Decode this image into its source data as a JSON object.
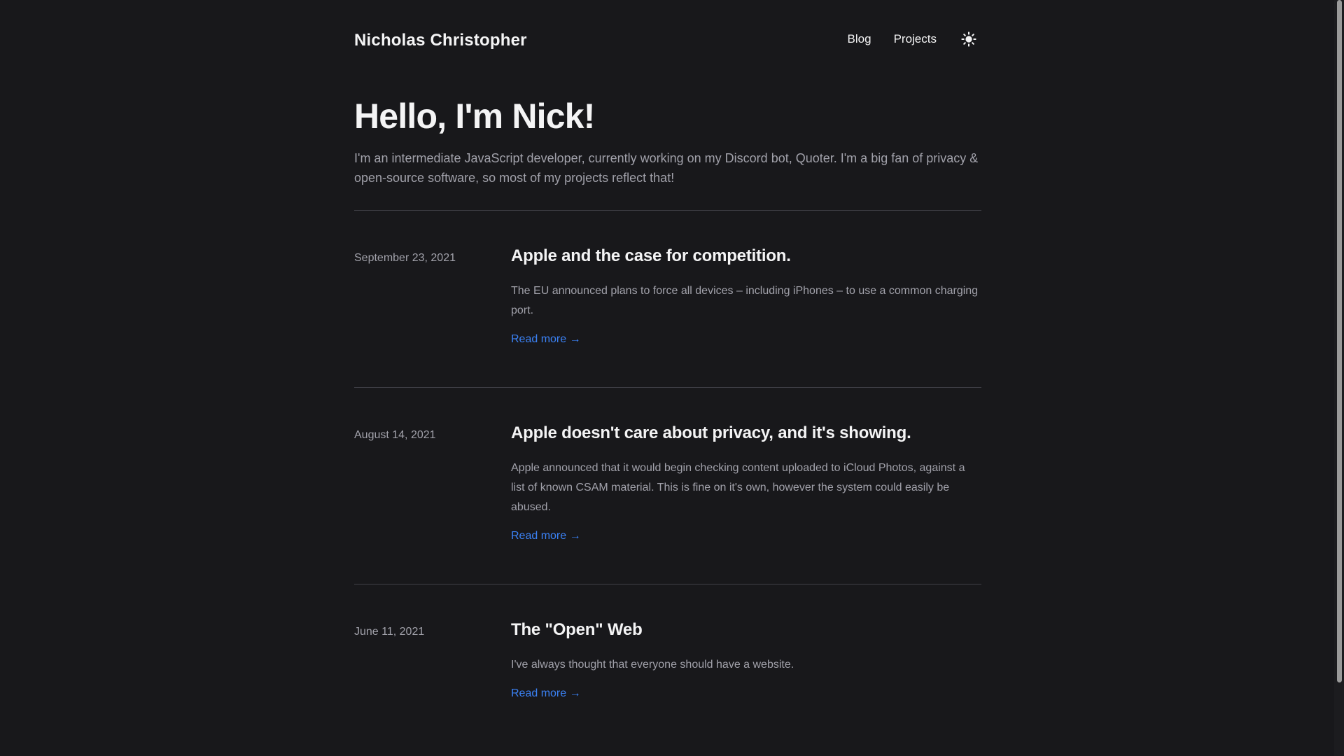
{
  "header": {
    "site_title": "Nicholas Christopher",
    "nav": {
      "blog": "Blog",
      "projects": "Projects"
    },
    "theme_toggle_icon": "sun-icon"
  },
  "hero": {
    "title": "Hello, I'm Nick!",
    "intro": "I'm an intermediate JavaScript developer, currently working on my Discord bot, Quoter. I'm a big fan of privacy & open-source software, so most of my projects reflect that!"
  },
  "posts": [
    {
      "date": "September 23, 2021",
      "title": "Apple and the case for competition.",
      "excerpt": "The EU announced plans to force all devices – including iPhones – to use a common charging port.",
      "read_more": "Read more →"
    },
    {
      "date": "August 14, 2021",
      "title": "Apple doesn't care about privacy, and it's showing.",
      "excerpt": "Apple announced that it would begin checking content uploaded to iCloud Photos, against a list of known CSAM material. This is fine on it's own, however the system could easily be abused.",
      "read_more": "Read more →"
    },
    {
      "date": "June 11, 2021",
      "title": "The \"Open\" Web",
      "excerpt": "I've always thought that everyone should have a website.",
      "read_more": "Read more →"
    }
  ],
  "colors": {
    "background": "#18181b",
    "text_primary": "#f4f4f5",
    "text_secondary": "#a1a1aa",
    "link": "#3b82f6",
    "divider": "#3f3f46"
  }
}
